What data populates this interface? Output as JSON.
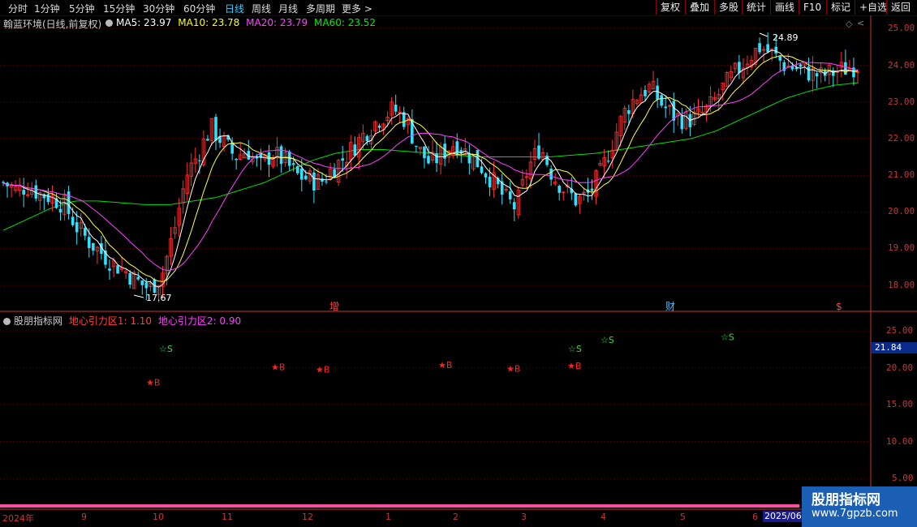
{
  "toolbar": {
    "periods": [
      "分时",
      "1分钟",
      "5分钟",
      "15分钟",
      "30分钟",
      "60分钟",
      "日线",
      "周线",
      "月线",
      "多周期",
      "更多"
    ],
    "active_period": "日线",
    "buttons": [
      "复权",
      "叠加",
      "多股",
      "统计",
      "画线",
      "F10",
      "标记",
      "+自选",
      "返回"
    ]
  },
  "main_info": {
    "title": "翰蓝环境(日线,前复权)",
    "ma5": "MA5: 23.97",
    "ma10": "MA10: 23.78",
    "ma20": "MA20: 23.79",
    "ma60": "MA60: 23.52"
  },
  "colors": {
    "up": "#ff3030",
    "down": "#30e0ff",
    "ma5": "#ffffff",
    "ma10": "#ffff40",
    "ma20": "#ff40ff",
    "ma60": "#00e000",
    "grid": "#5a0000",
    "axis": "#cc3030"
  },
  "price_axis": [
    "25.00",
    "24.00",
    "23.00",
    "22.00",
    "21.00",
    "20.00",
    "19.00",
    "18.00"
  ],
  "high_label": "24.89",
  "low_label": "17.67",
  "event_marks": [
    "增",
    "财",
    "$"
  ],
  "indicator": {
    "name": "股朋指标网",
    "line1": "地心引力区1: 1.10",
    "line2": "地心引力区2: 0.90",
    "axis": [
      "25.00",
      "20.00",
      "15.00",
      "10.00",
      "5.00"
    ],
    "current_value": "21.84",
    "buy_label": "B",
    "sell_label": "S"
  },
  "x_axis": [
    "2024年",
    "9",
    "10",
    "11",
    "12",
    "1",
    "2",
    "3",
    "4",
    "5",
    "6"
  ],
  "current_date": "2025/06",
  "watermark": {
    "line1": "股朋指标网",
    "line2": "www.7gpzb.com"
  },
  "chart_data": {
    "type": "candlestick",
    "ylim": [
      17.5,
      25.2
    ],
    "high": 24.89,
    "low": 17.67,
    "ma_latest": {
      "MA5": 23.97,
      "MA10": 23.78,
      "MA20": 23.79,
      "MA60": 23.52
    },
    "close_path": [
      20.8,
      20.6,
      20.7,
      20.5,
      20.4,
      20.2,
      19.6,
      19.2,
      18.9,
      18.6,
      18.4,
      18.1,
      17.9,
      18.3,
      19.5,
      21.0,
      21.6,
      22.3,
      21.9,
      21.5,
      21.7,
      21.2,
      21.6,
      21.4,
      21.0,
      20.9,
      20.8,
      21.2,
      21.5,
      21.9,
      22.3,
      22.6,
      22.8,
      22.5,
      21.7,
      21.3,
      21.6,
      21.9,
      21.6,
      21.3,
      20.9,
      20.4,
      20.1,
      21.2,
      21.8,
      21.0,
      20.6,
      20.3,
      20.5,
      21.1,
      22.0,
      22.8,
      23.2,
      23.4,
      22.9,
      22.6,
      22.5,
      22.6,
      22.9,
      23.4,
      23.8,
      24.2,
      24.5,
      24.3,
      24.0,
      23.9,
      23.8,
      23.7,
      23.8,
      23.9,
      24.0
    ],
    "ma60_path": [
      19.5,
      19.8,
      20.1,
      20.3,
      20.3,
      20.25,
      20.2,
      20.2,
      20.3,
      20.4,
      20.6,
      20.8,
      21.1,
      21.4,
      21.6,
      21.7,
      21.7,
      21.65,
      21.6,
      21.55,
      21.5,
      21.5,
      21.5,
      21.5,
      21.55,
      21.6,
      21.7,
      21.8,
      21.9,
      22.0,
      22.2,
      22.5,
      22.8,
      23.1,
      23.3,
      23.45,
      23.52
    ],
    "buy_signals": [
      18.0,
      20.1,
      19.8,
      20.4,
      19.9,
      20.3
    ],
    "sell_signals": [
      22.6,
      22.6,
      23.8,
      24.2
    ]
  }
}
